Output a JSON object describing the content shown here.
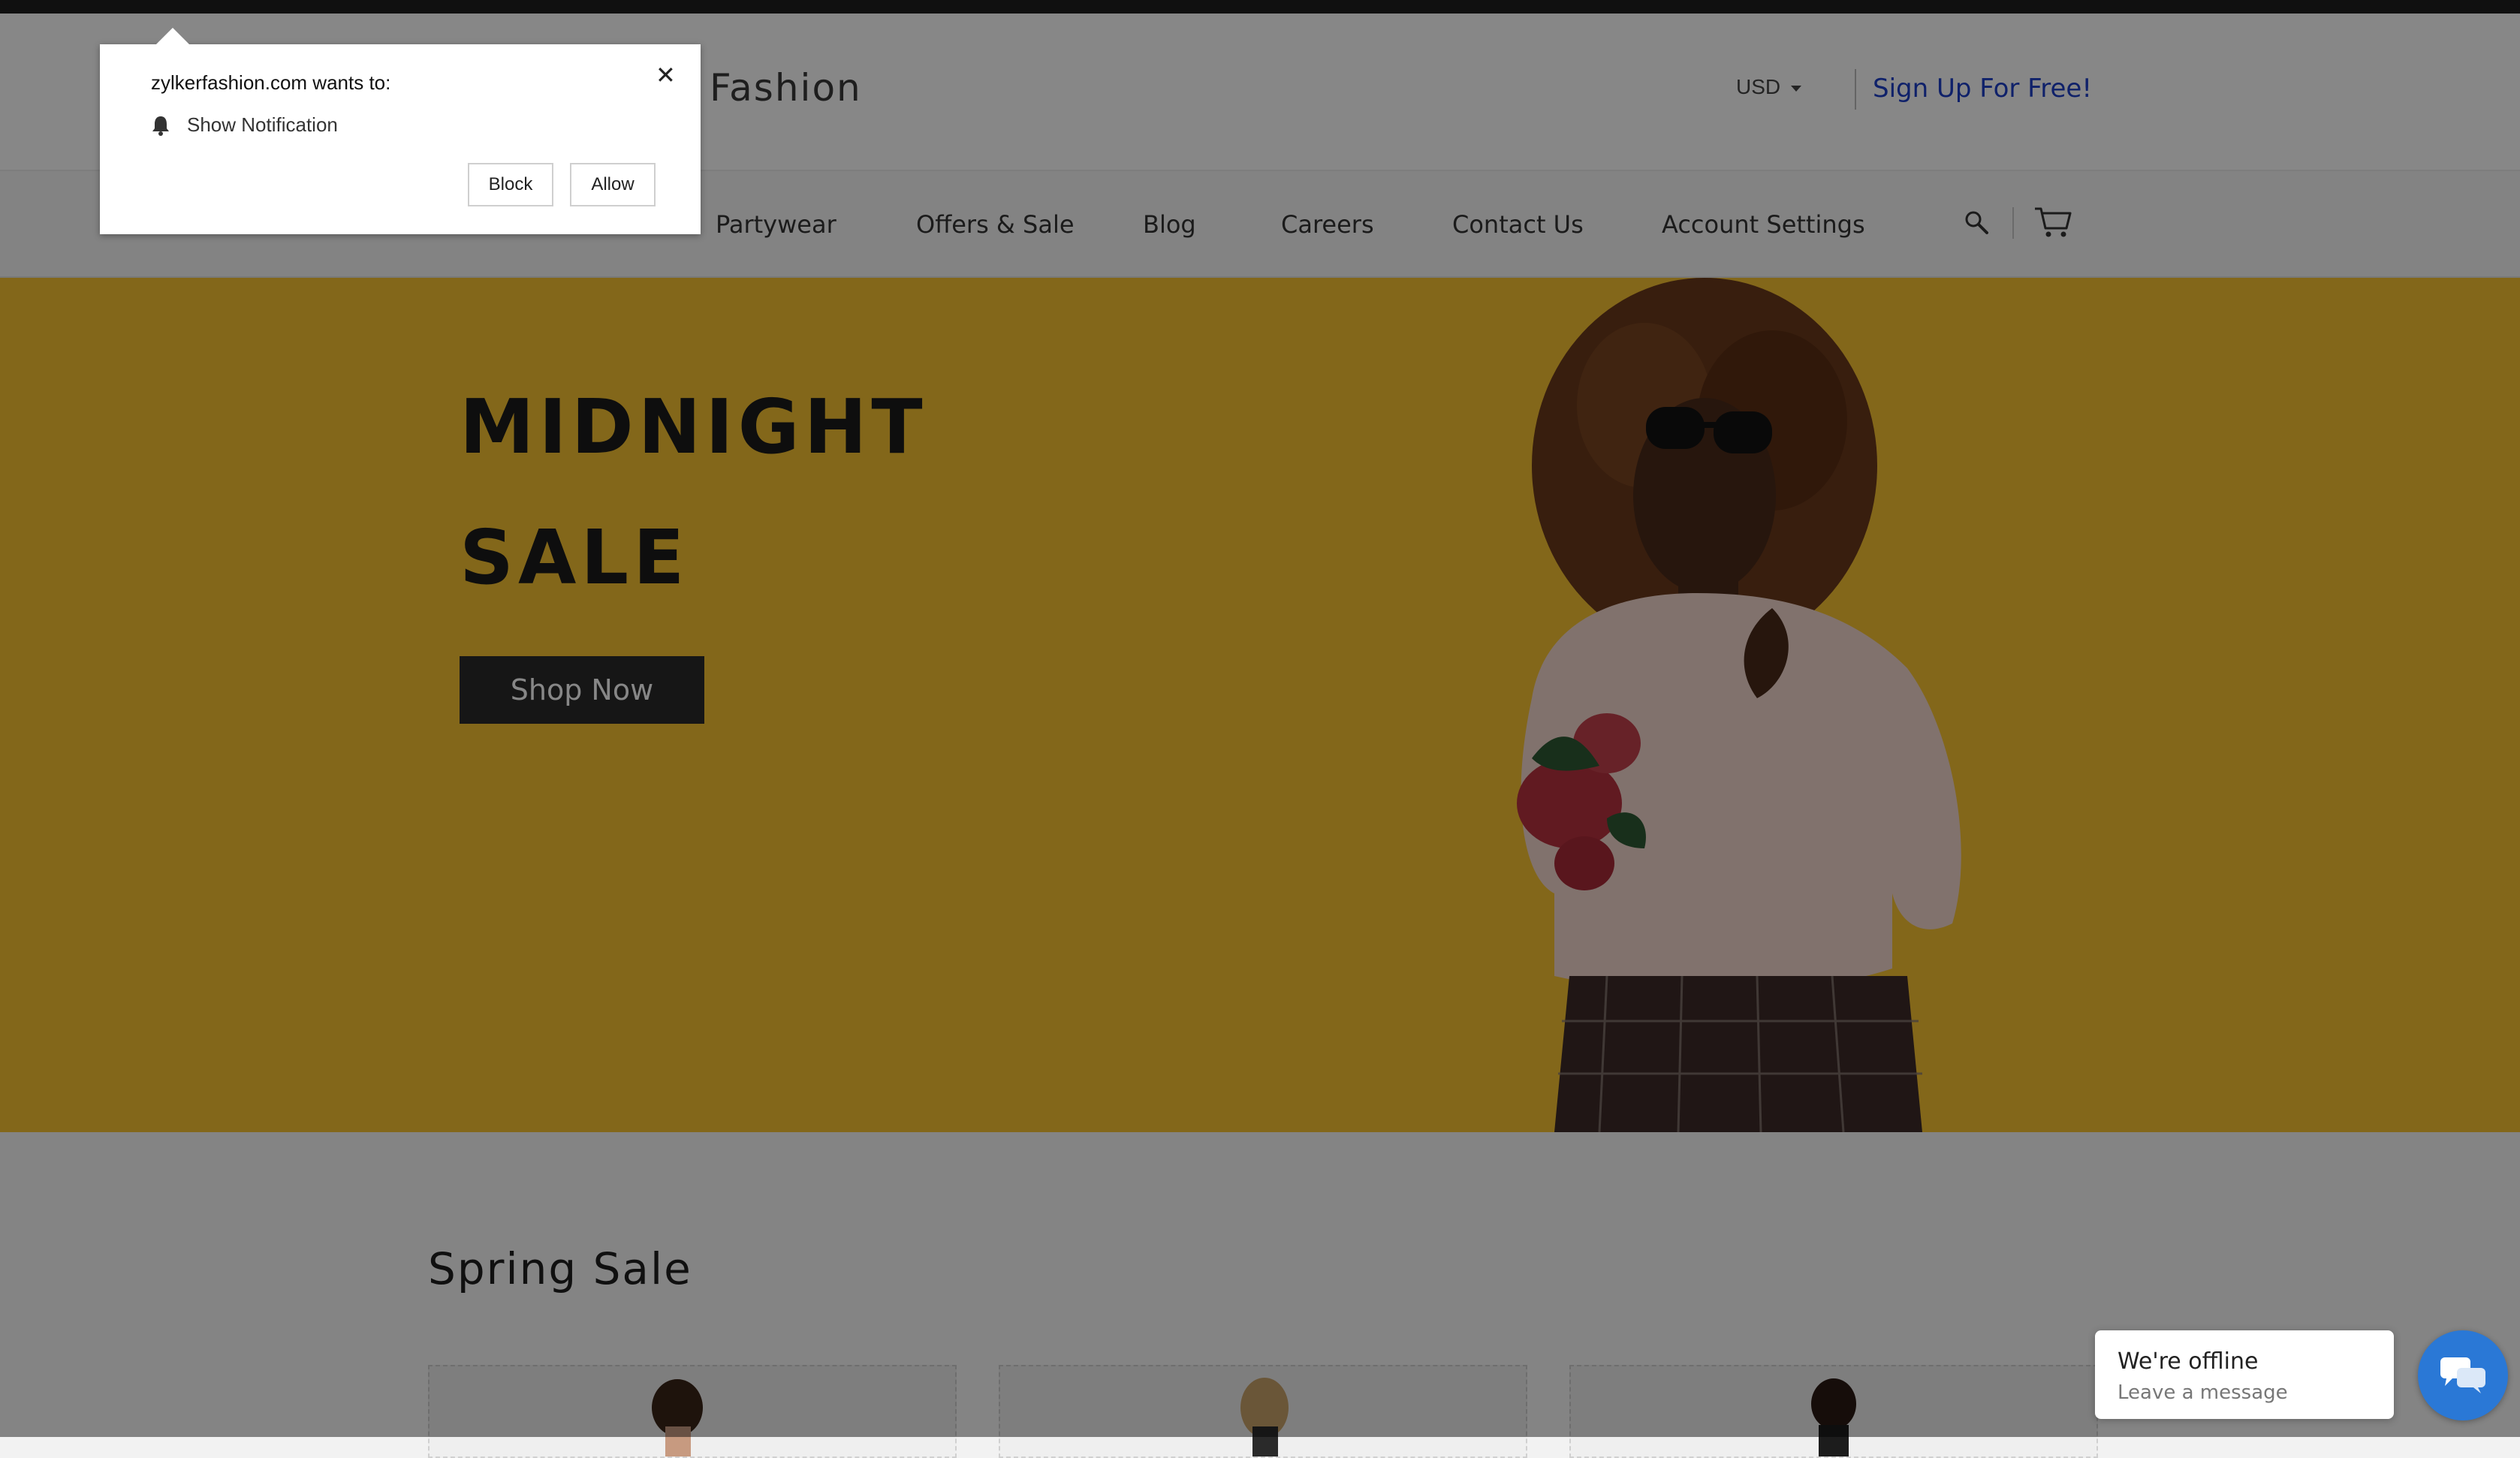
{
  "colors": {
    "hero_bg": "#f7c331",
    "signup_link": "#1d3fc8",
    "button_dark": "#2a2a2a",
    "chat_accent": "#2a78d6"
  },
  "header": {
    "brand_visible": "Fashion",
    "currency": "USD",
    "signup_label": "Sign Up For Free!"
  },
  "nav": {
    "items": [
      "Partywear",
      "Offers & Sale",
      "Blog",
      "Careers",
      "Contact Us",
      "Account Settings"
    ],
    "icons": [
      "search-icon",
      "cart-icon"
    ]
  },
  "hero": {
    "title_line1": "MIDNIGHT",
    "title_line2": "SALE",
    "cta_label": "Shop Now"
  },
  "section": {
    "title": "Spring Sale"
  },
  "popup": {
    "title": "zylkerfashion.com wants to:",
    "permission": "Show Notification",
    "close_symbol": "✕",
    "block_label": "Block",
    "allow_label": "Allow"
  },
  "chat": {
    "status": "We're offline",
    "subtitle": "Leave a message"
  }
}
